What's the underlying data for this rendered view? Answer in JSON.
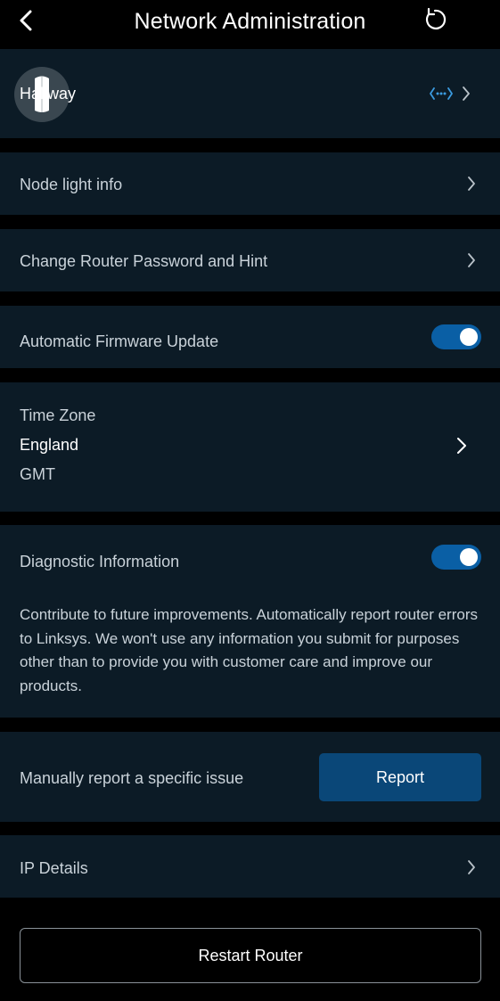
{
  "header": {
    "title": "Network Administration"
  },
  "node": {
    "name": "Hallway"
  },
  "rows": {
    "node_light": "Node light info",
    "change_password": "Change Router Password and Hint",
    "firmware_update": "Automatic Firmware Update",
    "ip_details": "IP Details"
  },
  "toggles": {
    "firmware_update_on": true,
    "diagnostic_on": true
  },
  "timezone": {
    "label": "Time Zone",
    "region": "England",
    "abbr": "GMT"
  },
  "diagnostic": {
    "label": "Diagnostic Information",
    "description": "Contribute to future improvements. Automatically report router errors to Linksys. We won't use any information you submit for purposes other than to provide you with customer care and improve our products."
  },
  "report": {
    "label": "Manually report a specific issue",
    "button": "Report"
  },
  "restart": {
    "button": "Restart Router"
  },
  "colors": {
    "background": "#000000",
    "card": "#0c1b26",
    "accent": "#0a5fa5",
    "button": "#0a4778",
    "link_icon": "#3b9be0"
  }
}
